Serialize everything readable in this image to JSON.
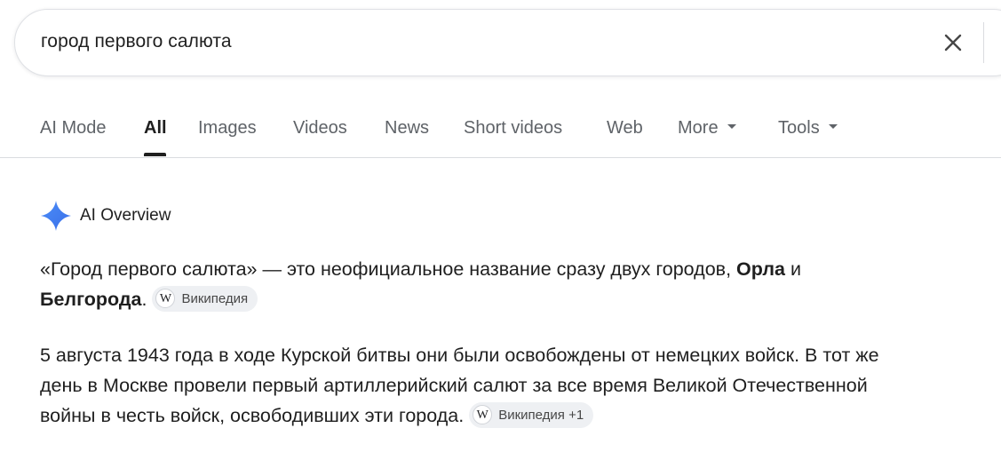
{
  "search": {
    "query": "город первого салюта",
    "clear_icon": "close-icon"
  },
  "tabs": [
    {
      "label": "AI Mode",
      "active": false
    },
    {
      "label": "All",
      "active": true
    },
    {
      "label": "Images",
      "active": false
    },
    {
      "label": "Videos",
      "active": false
    },
    {
      "label": "News",
      "active": false
    },
    {
      "label": "Short videos",
      "active": false
    },
    {
      "label": "Web",
      "active": false
    },
    {
      "label": "More",
      "active": false,
      "dropdown": true
    },
    {
      "label": "Tools",
      "active": false,
      "dropdown": true
    }
  ],
  "ai_overview": {
    "title": "AI Overview",
    "icon": "gemini-sparkle-icon",
    "paragraph1": {
      "text_before": "«Город первого салюта» — это неофициальное название сразу двух городов, ",
      "bold1": "Орла",
      "text_mid": " и ",
      "bold2": "Белгорода",
      "text_after": ".",
      "source_chip": {
        "label": "Википедия",
        "icon": "wikipedia-icon"
      }
    },
    "paragraph2": {
      "text": "5 августа 1943 года в ходе Курской битвы они были освобождены от немецких войск. В тот же день в Москве провели первый артиллерийский салют за все время Великой Отечественной войны в честь войск, освободивших эти города.",
      "source_chip": {
        "label": "Википедия +1",
        "icon": "wikipedia-icon"
      }
    }
  },
  "colors": {
    "accent_sparkle": "#4285f4",
    "tab_inactive": "#5f6368",
    "tab_active": "#1f1f1f",
    "chip_bg": "#eef0f3"
  }
}
